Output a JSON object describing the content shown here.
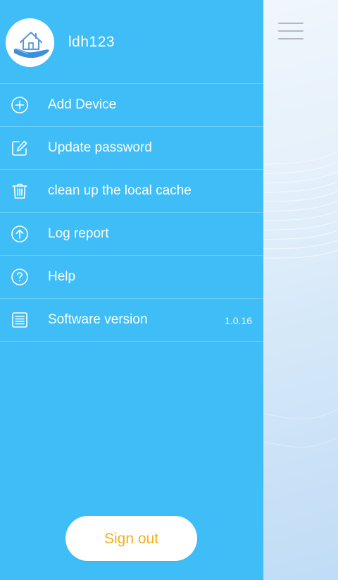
{
  "profile": {
    "username": "ldh123",
    "avatar_icon": "house-hand-logo-icon"
  },
  "menu": {
    "items": [
      {
        "label": "Add Device",
        "icon": "plus-circle-icon"
      },
      {
        "label": "Update password",
        "icon": "edit-pencil-icon"
      },
      {
        "label": "clean up the local cache",
        "icon": "trash-icon"
      },
      {
        "label": "Log report",
        "icon": "upload-arrow-circle-icon"
      },
      {
        "label": "Help",
        "icon": "question-circle-icon"
      },
      {
        "label": "Software version",
        "icon": "document-lines-icon",
        "value": "1.0.16"
      }
    ]
  },
  "actions": {
    "sign_out": "Sign out"
  },
  "colors": {
    "drawer": "#3fbdf6",
    "sign_out_text": "#f0b21c",
    "menu_text": "#ffffff"
  }
}
